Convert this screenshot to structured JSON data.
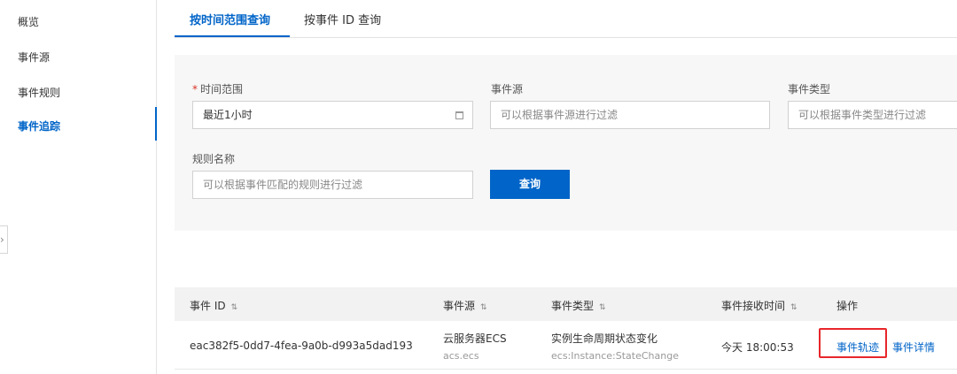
{
  "sidebar": {
    "items": [
      {
        "label": "概览"
      },
      {
        "label": "事件源"
      },
      {
        "label": "事件规则"
      },
      {
        "label": "事件追踪"
      }
    ],
    "active_index": 3
  },
  "tabs": [
    {
      "label": "按时间范围查询"
    },
    {
      "label": "按事件 ID 查询"
    }
  ],
  "filters": {
    "time_range": {
      "required_mark": "*",
      "label": "时间范围",
      "value": "最近1小时"
    },
    "event_source": {
      "label": "事件源",
      "placeholder": "可以根据事件源进行过滤"
    },
    "event_type": {
      "label": "事件类型",
      "placeholder": "可以根据事件类型进行过滤"
    },
    "rule_name": {
      "label": "规则名称",
      "placeholder": "可以根据事件匹配的规则进行过滤"
    },
    "query_button": "查询"
  },
  "table": {
    "columns": [
      {
        "label": "事件 ID",
        "sortable": true
      },
      {
        "label": "事件源",
        "sortable": true
      },
      {
        "label": "事件类型",
        "sortable": true
      },
      {
        "label": "事件接收时间",
        "sortable": true
      },
      {
        "label": "操作",
        "sortable": false
      }
    ],
    "sort_glyph": "⇅",
    "rows": [
      {
        "event_id": "eac382f5-0dd7-4fea-9a0b-d993a5dad193",
        "source_name": "云服务器ECS",
        "source_code": "acs.ecs",
        "type_name": "实例生命周期状态变化",
        "type_code": "ecs:Instance:StateChange",
        "received_time": "今天 18:00:53",
        "actions": [
          "事件轨迹",
          "事件详情"
        ]
      }
    ]
  },
  "colors": {
    "accent": "#0064c8",
    "highlight_box": "#e8262b",
    "panel_bg": "#f7f7f7"
  },
  "icons": {
    "collapse": "chevron-right-icon",
    "date_picker": "calendar-icon"
  }
}
